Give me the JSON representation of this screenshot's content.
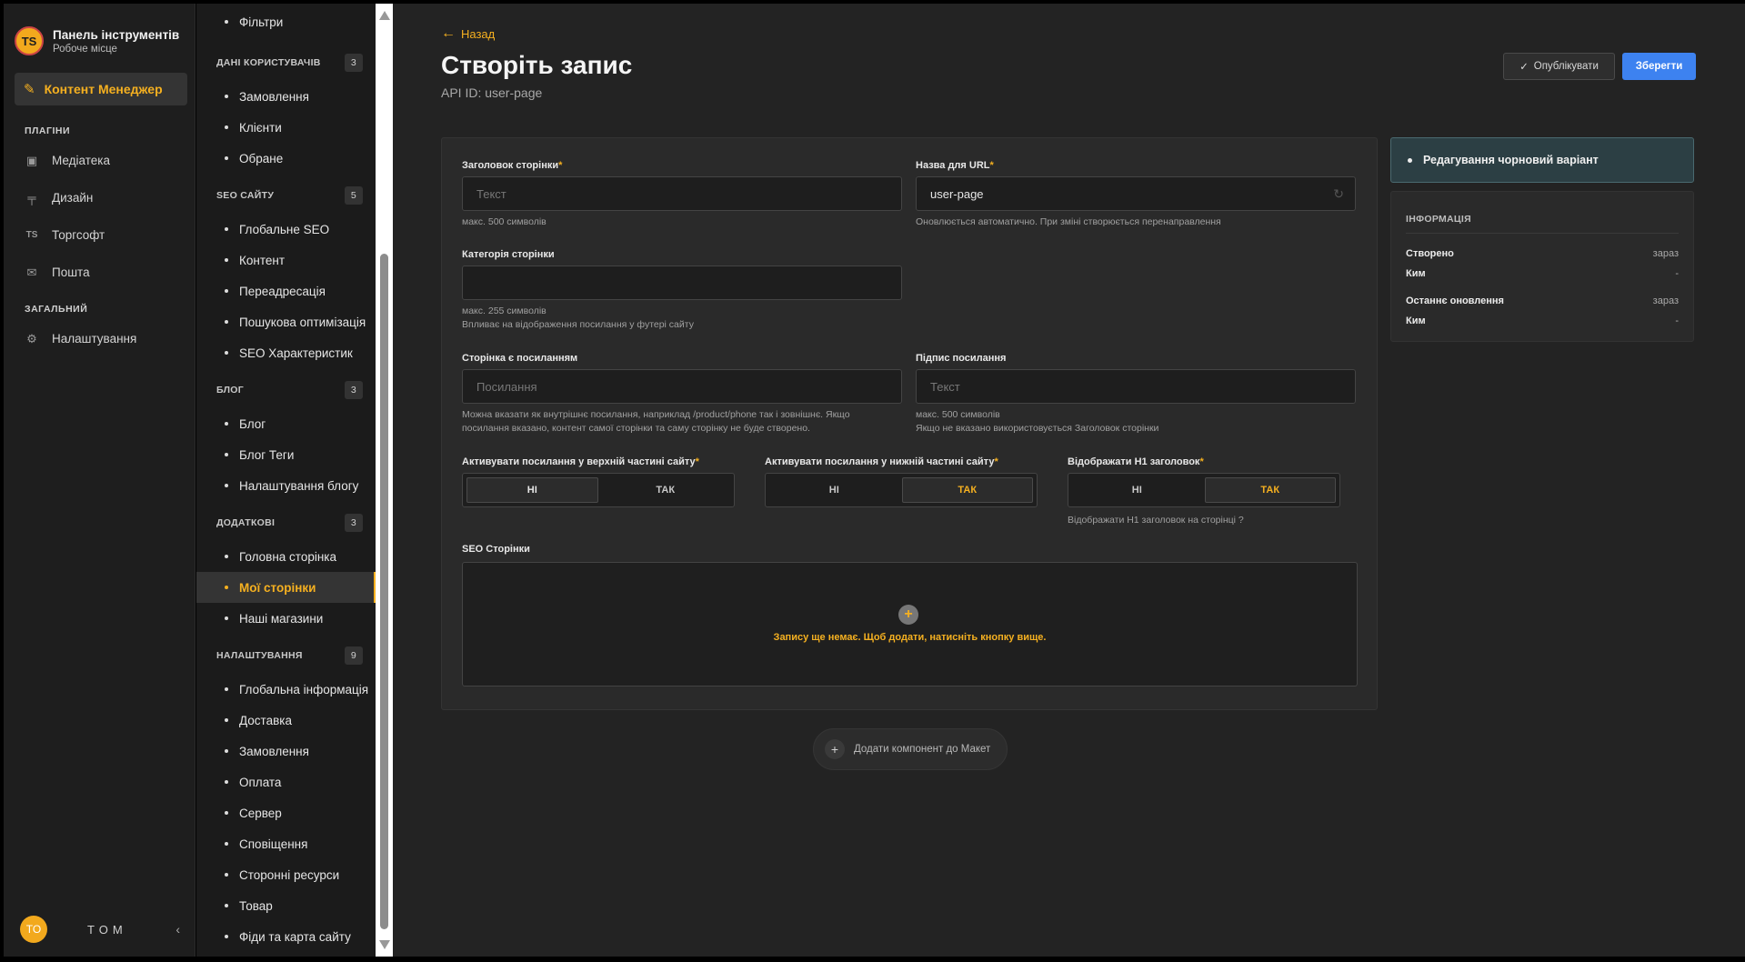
{
  "sidebar": {
    "brand_logo": "TS",
    "brand_title": "Панель інструментів",
    "brand_subtitle": "Робоче місце",
    "active_item": "Контент Менеджер",
    "section_plugins": "ПЛАГІНИ",
    "plugins": [
      {
        "label": "Медіатека",
        "icon": "image-icon"
      },
      {
        "label": "Дизайн",
        "icon": "paint-roller-icon"
      },
      {
        "label": "Торгсофт",
        "icon": "ts-icon"
      },
      {
        "label": "Пошта",
        "icon": "mail-icon"
      }
    ],
    "section_general": "ЗАГАЛЬНИЙ",
    "settings_label": "Налаштування",
    "user_initials": "TO",
    "user_name": "TOM"
  },
  "menu": {
    "top_item": "Фільтри",
    "groups": [
      {
        "title": "ДАНІ КОРИСТУВАЧІВ",
        "count": "3",
        "items": [
          "Замовлення",
          "Клієнти",
          "Обране"
        ]
      },
      {
        "title": "SEO САЙТУ",
        "count": "5",
        "items": [
          "Глобальне SEO",
          "Контент",
          "Переадресація",
          "Пошукова оптимізація",
          "SEO Характеристик"
        ]
      },
      {
        "title": "БЛОГ",
        "count": "3",
        "items": [
          "Блог",
          "Блог Теги",
          "Налаштування блогу"
        ]
      },
      {
        "title": "ДОДАТКОВІ",
        "count": "3",
        "items": [
          "Головна сторінка",
          "Мої сторінки",
          "Наші магазини"
        ]
      },
      {
        "title": "НАЛАШТУВАННЯ",
        "count": "9",
        "items": [
          "Глобальна інформація",
          "Доставка",
          "Замовлення",
          "Оплата",
          "Сервер",
          "Сповіщення",
          "Сторонні ресурси",
          "Товар",
          "Фіди та карта сайту"
        ]
      }
    ]
  },
  "header": {
    "back": "Назад",
    "title": "Створіть запис",
    "api_id": "API ID: user-page",
    "publish": "Опублікувати",
    "save": "Зберегти"
  },
  "form": {
    "page_title_label": "Заголовок сторінки",
    "page_title_placeholder": "Текст",
    "page_title_hint": "макс. 500 символів",
    "url_label": "Назва для URL",
    "url_value": "user-page",
    "url_hint": "Оновлюється автоматично. При зміні створюється перенаправлення",
    "category_label": "Категорія сторінки",
    "category_hint1": "макс. 255 символів",
    "category_hint2": "Впливає на відображення посилання у футері сайту",
    "link_label": "Сторінка є посиланням",
    "link_placeholder": "Посилання",
    "link_hint1": "Можна вказати як внутрішнє посилання, наприклад /product/phone так і зовнішнє. Якщо",
    "link_hint2": "посилання вказано, контент самої сторінки та саму сторінку не буде створено.",
    "caption_label": "Підпис посилання",
    "caption_placeholder": "Текст",
    "caption_hint1": "макс. 500 символів",
    "caption_hint2": "Якщо не вказано використовується Заголовок сторінки",
    "toggle_top_label": "Активувати посилання у верхній частині сайту",
    "toggle_bottom_label": "Активувати посилання у нижній частині сайту",
    "toggle_h1_label": "Відображати H1 заголовок",
    "toggle_h1_hint": "Відображати H1 заголовок на сторінці ?",
    "opt_no": "НІ",
    "opt_yes": "ТАК",
    "seo_label": "SEO Сторінки",
    "seo_empty": "Запису ще немає. Щоб додати, натисніть кнопку вище."
  },
  "add_component": "Додати компонент до Макет",
  "status": "Редагування чорновий варіант",
  "info": {
    "title": "ІНФОРМАЦІЯ",
    "created_k": "Створено",
    "created_v": "зараз",
    "by_k": "Ким",
    "by_v": "-",
    "updated_k": "Останнє оновлення",
    "updated_v": "зараз",
    "by2_k": "Ким",
    "by2_v": "-"
  },
  "colors": {
    "accent": "#f5b020",
    "primary": "#3d82f0",
    "background": "#232323"
  }
}
